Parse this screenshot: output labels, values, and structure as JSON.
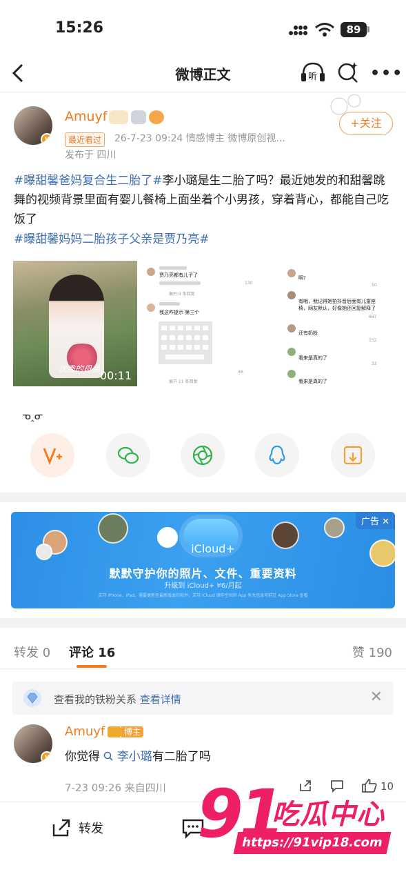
{
  "status_bar": {
    "time": "15:26",
    "battery": "89"
  },
  "nav": {
    "title": "微博正文",
    "listen_label": "听"
  },
  "post": {
    "author": "Amuyf",
    "recent_tag": "最近看过",
    "meta": "26-7-23 09:24  情感博主 微博原创视...",
    "location": "发布于 四川",
    "follow_label": "+关注",
    "text_tag1": "#曝甜馨爸妈复合生二胎了#",
    "text_body": "李小璐是生二胎了吗？最近她发的和甜馨跳舞的视频背景里面有婴儿餐椅上面坐着个小男孩，穿着背心，都能自己吃饭了",
    "text_tag2": "#曝甜馨妈妈二胎孩子父亲是贾乃亮#",
    "video": {
      "caption": "优秀的母亲",
      "duration": "00:11"
    },
    "screenshot1": {
      "c1_text": "贾乃亮都有儿子了",
      "c1_likes": "130",
      "c1_expand": "展开 9 条回复",
      "c2_text": "我这咋提示 第三个",
      "c2_likes": "36",
      "c2_expand": "展开 11 条回复"
    },
    "screenshot2": {
      "r1": "啊?",
      "r1_likes": "50",
      "r2": "有哦，我记得她拍抖音后面有儿童座椅，网友默认，好像她还回复解释了",
      "r2_likes": "697",
      "r3": "还有奶粉",
      "r3_likes": "152",
      "r4": "看来是真的了",
      "r4_likes": "32",
      "r5": "看来是真的了"
    }
  },
  "emoticon": "ᓀ‸ᓂ",
  "share_icons": [
    "v-plus-icon",
    "wechat-icon",
    "moments-icon",
    "qq-icon",
    "save-image-icon"
  ],
  "ad": {
    "badge": "广告 ✕",
    "product": "iCloud+",
    "headline": "默默守护你的照片、文件、重要资料",
    "sub": "升级到 iCloud+ ¥6/月起",
    "fine": "支持 iPhone、iPad。需要更新至最新版本的软件，支持 iCloud 储存空间的 App 有关信息可前往 App Store 查看"
  },
  "tabs": {
    "repost": "转发 0",
    "comments": "评论 16",
    "likes": "赞 190"
  },
  "fan_bar": {
    "text": "查看我的铁粉关系",
    "link": "查看详情"
  },
  "comment": {
    "author": "Amuyf",
    "tag": "博主",
    "text_prefix": "你觉得",
    "text_link": "李小璐",
    "text_suffix": "有二胎了吗",
    "meta": "7-23 09:26  来自四川",
    "likes": "10"
  },
  "bottom_bar": {
    "repost_label": "转发"
  },
  "watermark": {
    "number": "91",
    "name": "吃瓜中心",
    "url": "https://91vip18.com"
  },
  "colors": {
    "accent": "#f07c22",
    "link": "#3f6fb0",
    "watermark": "#ee1f63",
    "ad_blue": "#2d8fe6"
  }
}
